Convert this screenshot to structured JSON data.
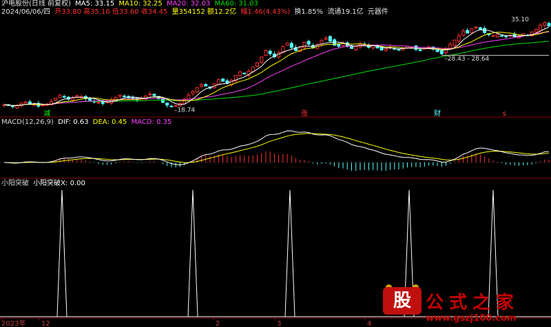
{
  "header": {
    "symbol": "沪电股份(日线 前复权)",
    "ma5": "MA5: 33.15",
    "ma10": "MA10: 32.25",
    "ma20": "MA20: 32.03",
    "ma60": "MA60: 31.03",
    "date": "2024/06/06/四",
    "open": "开33.80",
    "high": "高35.10",
    "low": "低33.60",
    "close": "收34.45",
    "volume": "量354152",
    "amount": "额12.2亿",
    "change": "幅1.46(4.43%)",
    "turnover": "换1.85%",
    "float": "流通19.1亿",
    "sector": "元器件"
  },
  "macd_header": {
    "name": "MACD(12,26,9)",
    "dif": "DIF: 0.63",
    "dea": "DEA: 0.45",
    "macd": "MACD: 0.35"
  },
  "ind_header": {
    "name": "小阳突破",
    "value": "小阳突破X: 0.00"
  },
  "watermark": {
    "logo": "股",
    "name": "公式之家",
    "url": "www.gszj100.com"
  },
  "colors": {
    "up": "#ff3030",
    "down": "#54ffff",
    "ma5": "#ffffff",
    "ma10": "#ffff00",
    "ma20": "#ff40ff",
    "ma60": "#00e000",
    "dif": "#ffffff",
    "dea": "#ffff00"
  },
  "chart_data": [
    {
      "type": "candlestick",
      "title": "沪电股份(日线 前复权)",
      "annotations": [
        {
          "label": "18.74",
          "x_index": 39,
          "price": 18.74
        },
        {
          "label": "35.10",
          "x_index": 123,
          "price": 35.1
        },
        {
          "label": "28.43 - 28.64",
          "x_index": 102,
          "price": 28.43
        }
      ],
      "ylim": [
        17.5,
        36.5
      ],
      "markers": [
        {
          "label": "减",
          "x_index": 10
        },
        {
          "label": "涨",
          "x_index": 70
        },
        {
          "label": "财",
          "x_index": 101
        },
        {
          "label": "s",
          "x_index": 117
        }
      ],
      "closes": [
        19.6,
        19.4,
        19.2,
        19.5,
        19.9,
        20.1,
        19.8,
        19.6,
        19.3,
        19.5,
        19.7,
        20.2,
        20.8,
        21.4,
        21.0,
        20.6,
        20.8,
        21.3,
        21.1,
        20.7,
        20.4,
        20.2,
        20.0,
        19.8,
        20.1,
        20.5,
        20.9,
        21.4,
        21.2,
        20.9,
        20.7,
        20.5,
        20.8,
        21.2,
        21.6,
        21.3,
        20.7,
        20.0,
        19.5,
        19.2,
        19.4,
        19.8,
        20.6,
        21.4,
        22.1,
        22.8,
        23.4,
        23.1,
        22.7,
        23.5,
        24.3,
        24.0,
        23.6,
        24.2,
        25.1,
        25.8,
        25.4,
        25.9,
        26.7,
        27.5,
        28.6,
        29.8,
        29.2,
        28.6,
        29.4,
        30.6,
        31.2,
        30.4,
        29.8,
        30.5,
        31.4,
        31.0,
        30.3,
        30.9,
        31.7,
        32.2,
        31.6,
        30.8,
        30.6,
        31.2,
        30.7,
        30.2,
        30.6,
        31.1,
        30.9,
        30.4,
        30.7,
        30.3,
        29.9,
        30.1,
        30.5,
        30.2,
        29.9,
        30.3,
        30.6,
        30.4,
        30.0,
        29.8,
        30.2,
        30.5,
        30.1,
        29.6,
        29.2,
        30.2,
        31.0,
        31.8,
        32.6,
        33.5,
        33.1,
        33.9,
        34.3,
        33.8,
        33.2,
        32.8,
        32.6,
        32.9,
        32.5,
        32.4,
        32.7,
        32.4,
        32.6,
        33.0,
        32.7,
        33.3,
        33.8,
        34.6,
        35.1,
        34.45
      ]
    },
    {
      "type": "line",
      "title": "MACD(12,26,9)",
      "series": [
        {
          "name": "DIF",
          "values": []
        },
        {
          "name": "DEA",
          "values": []
        },
        {
          "name": "MACD",
          "values": []
        }
      ]
    },
    {
      "type": "line",
      "title": "小阳突破",
      "series": [
        {
          "name": "小阳突破X",
          "spike_indices": [
            21,
            67,
            97,
            137,
            166
          ]
        }
      ],
      "x_ticks": [
        {
          "label": "2023年",
          "x_index": 0
        },
        {
          "label": "12",
          "x_index": 13
        },
        {
          "label": "2",
          "x_index": 75
        },
        {
          "label": "3",
          "x_index": 98
        },
        {
          "label": "4",
          "x_index": 131
        }
      ]
    }
  ]
}
